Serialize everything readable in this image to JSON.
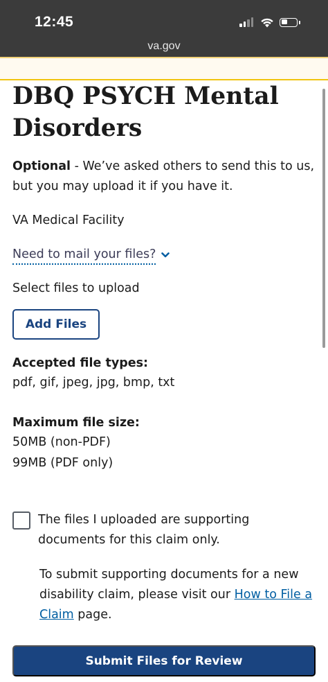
{
  "status_bar": {
    "time": "12:45",
    "url": "va.gov"
  },
  "page": {
    "title": "DBQ PSYCH Mental Disorders",
    "optional_label": "Optional",
    "optional_text": " - We’ve asked others to send this to us, but you may upload it if you have it.",
    "facility": "VA Medical Facility",
    "mail_link": "Need to mail your files?",
    "select_label": "Select files to upload",
    "add_files_button": "Add Files",
    "accepted_types_heading": "Accepted file types:",
    "accepted_types": "pdf, gif, jpeg, jpg, bmp, txt",
    "max_size_heading": "Maximum file size:",
    "max_size_non_pdf": "50MB (non-PDF)",
    "max_size_pdf": "99MB (PDF only)",
    "checkbox_label": "The files I uploaded are supporting documents for this claim only.",
    "checkbox_checked": false,
    "note_prefix": "To submit supporting documents for a new disability claim, please visit our ",
    "note_link": "How to File a Claim",
    "note_suffix": " page.",
    "submit_button": "Submit Files for Review"
  },
  "colors": {
    "primary": "#1a4480",
    "link": "#005ea2",
    "status_bar_bg": "#3b3b3b",
    "banner_border": "#f1c40f"
  }
}
